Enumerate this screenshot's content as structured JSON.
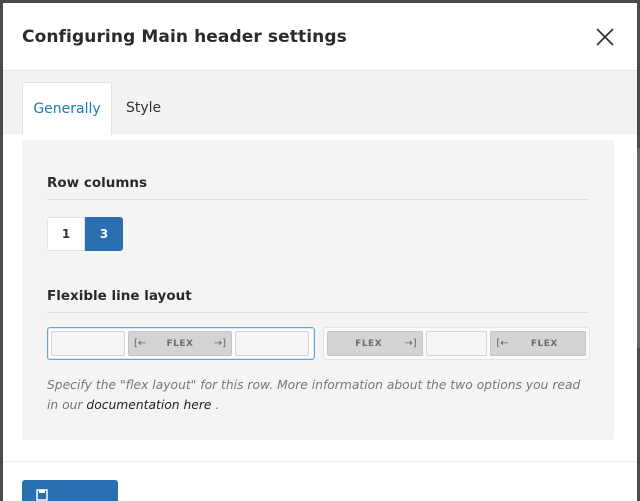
{
  "modal": {
    "title": "Configuring Main header settings"
  },
  "tabs": [
    {
      "label": "Generally",
      "active": true
    },
    {
      "label": "Style",
      "active": false
    }
  ],
  "row_columns": {
    "title": "Row columns",
    "options": [
      "1",
      "3"
    ],
    "selected": "3"
  },
  "flexible_layout": {
    "title": "Flexible line layout",
    "option_a": {
      "flex_label": "FLEX"
    },
    "option_b": {
      "flex_label_1": "FLEX",
      "flex_label_2": "FLEX"
    },
    "selected": "option_a"
  },
  "hint": {
    "text": "Specify the \"flex layout\" for this row. More information about the two options you read in our",
    "link_text": "documentation here",
    "suffix": "."
  },
  "colors": {
    "accent": "#2a6fb0",
    "tab_active": "#1c7da8",
    "selected_border": "#5fa9d9"
  }
}
